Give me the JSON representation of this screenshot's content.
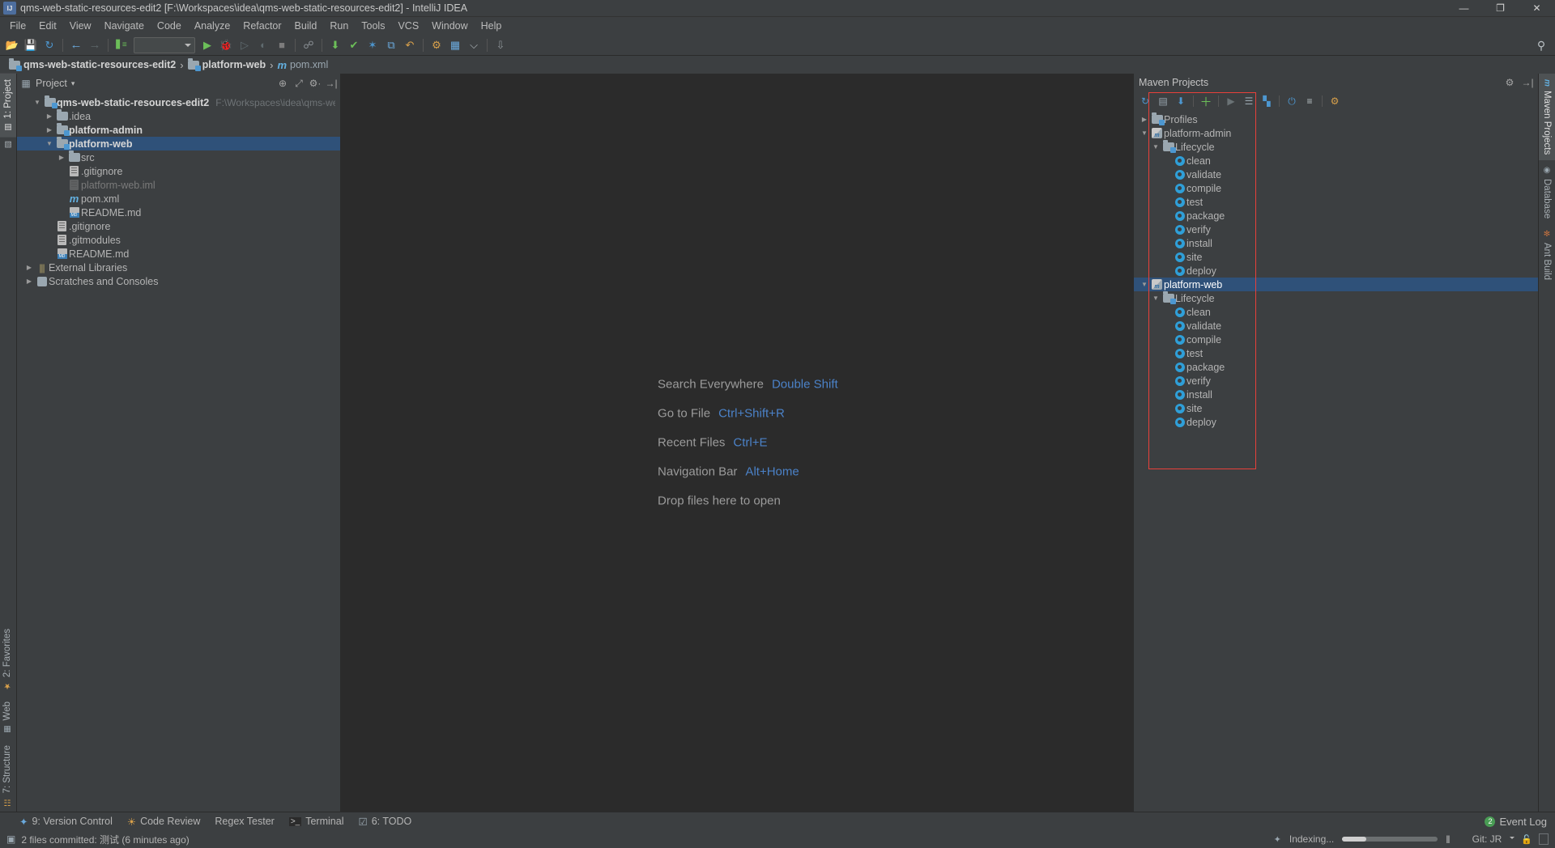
{
  "window": {
    "title": "qms-web-static-resources-edit2 [F:\\Workspaces\\idea\\qms-web-static-resources-edit2] - IntelliJ IDEA",
    "app_icon": "intellij-idea-icon",
    "minimize_label": "—",
    "maximize_label": "❐",
    "close_label": "✕"
  },
  "menu": {
    "items": [
      {
        "label": "File"
      },
      {
        "label": "Edit"
      },
      {
        "label": "View"
      },
      {
        "label": "Navigate"
      },
      {
        "label": "Code"
      },
      {
        "label": "Analyze"
      },
      {
        "label": "Refactor"
      },
      {
        "label": "Build"
      },
      {
        "label": "Run"
      },
      {
        "label": "Tools"
      },
      {
        "label": "VCS"
      },
      {
        "label": "Window"
      },
      {
        "label": "Help"
      }
    ]
  },
  "toolbar": {
    "buttons": [
      {
        "name": "open-project-icon",
        "glyph": "📂",
        "color": "#d9a14b"
      },
      {
        "name": "save-all-icon",
        "glyph": "💾",
        "color": "#b9c0c4"
      },
      {
        "name": "sync-icon",
        "glyph": "↻",
        "color": "#4d97d0"
      },
      {
        "name": "back-arrow-icon",
        "glyph": "←",
        "color": "#6aa9dc"
      },
      {
        "name": "forward-arrow-icon",
        "glyph": "→",
        "color": "#5c6669"
      },
      {
        "name": "compile-icon",
        "glyph": "▐",
        "color": "#6cbf59"
      }
    ],
    "run_config_value": "",
    "run_buttons": [
      {
        "name": "run-icon",
        "glyph": "▶",
        "color": "#6cbf59"
      },
      {
        "name": "debug-icon",
        "glyph": "🐞",
        "color": "#5f6a6e"
      },
      {
        "name": "run-coverage-icon",
        "glyph": "▷",
        "color": "#5f6a6e"
      },
      {
        "name": "profile-icon",
        "glyph": "◔",
        "color": "#5f6a6e"
      },
      {
        "name": "stop-icon",
        "glyph": "■",
        "color": "#7c7c7c"
      }
    ],
    "right_buttons": [
      {
        "name": "update-project-icon",
        "glyph": "⬇",
        "color": "#6cbf59"
      },
      {
        "name": "commit-icon",
        "glyph": "✔",
        "color": "#6cbf59"
      },
      {
        "name": "vcs-push-icon",
        "glyph": "✦",
        "color": "#4d97d0"
      },
      {
        "name": "vcs-history-icon",
        "glyph": "⧉",
        "color": "#6aa9dc"
      },
      {
        "name": "undo-icon",
        "glyph": "↶",
        "color": "#d9a14b"
      },
      {
        "name": "settings-icon",
        "glyph": "⚙",
        "color": "#d9a14b"
      },
      {
        "name": "project-structure-icon",
        "glyph": "▦",
        "color": "#6aa9dc"
      },
      {
        "name": "search-everywhere-icon",
        "glyph": "⌕",
        "color": "#b9c0c4"
      }
    ],
    "far_right": [
      {
        "name": "search-icon",
        "glyph": "⌕"
      }
    ]
  },
  "breadcrumb": {
    "items": [
      {
        "label": "qms-web-static-resources-edit2",
        "icon": "module-folder-icon",
        "bold": true
      },
      {
        "label": "platform-web",
        "icon": "module-folder-icon",
        "bold": true
      },
      {
        "label": "pom.xml",
        "icon": "maven-file-icon",
        "bold": false
      }
    ],
    "separator": "›"
  },
  "left_rail": {
    "top": [
      {
        "label": "1: Project",
        "icon": "project-icon",
        "active": true
      },
      {
        "label": "",
        "icon": "structure-small-icon",
        "active": false
      }
    ],
    "bottom": [
      {
        "label": "2: Favorites",
        "icon": "star-icon",
        "active": false
      },
      {
        "label": "Web",
        "icon": "web-icon",
        "active": false
      },
      {
        "label": "7: Structure",
        "icon": "structure-icon",
        "active": false
      }
    ]
  },
  "right_rail": {
    "items": [
      {
        "label": "Maven Projects",
        "icon": "maven-icon",
        "active": true
      },
      {
        "label": "Database",
        "icon": "database-icon",
        "active": false
      },
      {
        "label": "Ant Build",
        "icon": "ant-icon",
        "active": false
      }
    ]
  },
  "project_panel": {
    "title": "Project",
    "title_icon": "project-view-icon",
    "dropdown_caret": "▾",
    "header_icons": [
      {
        "name": "locate-icon",
        "glyph": "⊕"
      },
      {
        "name": "expand-all-icon",
        "glyph": "⤢"
      },
      {
        "name": "collapse-all-icon",
        "glyph": "⚙·"
      },
      {
        "name": "hide-icon",
        "glyph": "→|"
      }
    ],
    "tree": [
      {
        "label": "qms-web-static-resources-edit2",
        "indent": 0,
        "twist": "▼",
        "icon": "project-folder-icon",
        "bold": true,
        "path": "F:\\Workspaces\\idea\\qms-web-static-re"
      },
      {
        "label": ".idea",
        "indent": 1,
        "twist": "▶",
        "icon": "folder-icon",
        "bold": false,
        "path": ""
      },
      {
        "label": "platform-admin",
        "indent": 1,
        "twist": "▶",
        "icon": "module-folder-icon",
        "bold": true,
        "path": ""
      },
      {
        "label": "platform-web",
        "indent": 1,
        "twist": "▼",
        "icon": "module-folder-icon",
        "bold": true,
        "path": "",
        "selected": true
      },
      {
        "label": "src",
        "indent": 2,
        "twist": "▶",
        "icon": "folder-icon",
        "bold": false,
        "path": ""
      },
      {
        "label": ".gitignore",
        "indent": 3,
        "twist": "",
        "icon": "file-icon",
        "bold": false,
        "path": ""
      },
      {
        "label": "platform-web.iml",
        "indent": 3,
        "twist": "",
        "icon": "iml-file-icon",
        "bold": false,
        "dim": true,
        "path": ""
      },
      {
        "label": "pom.xml",
        "indent": 3,
        "twist": "",
        "icon": "maven-file-icon",
        "bold": false,
        "path": ""
      },
      {
        "label": "README.md",
        "indent": 3,
        "twist": "",
        "icon": "markdown-file-icon",
        "bold": false,
        "path": ""
      },
      {
        "label": ".gitignore",
        "indent": 2,
        "twist": "",
        "icon": "file-icon",
        "bold": false,
        "path": ""
      },
      {
        "label": ".gitmodules",
        "indent": 2,
        "twist": "",
        "icon": "file-icon",
        "bold": false,
        "path": ""
      },
      {
        "label": "README.md",
        "indent": 2,
        "twist": "",
        "icon": "markdown-file-icon",
        "bold": false,
        "path": ""
      },
      {
        "label": "External Libraries",
        "indent": 0,
        "twist": "▶",
        "icon": "library-icon",
        "bold": false,
        "path": ""
      },
      {
        "label": "Scratches and Consoles",
        "indent": 0,
        "twist": "▶",
        "icon": "scratches-icon",
        "bold": false,
        "path": ""
      }
    ]
  },
  "editor": {
    "hints": [
      {
        "label": "Search Everywhere",
        "shortcut": "Double Shift"
      },
      {
        "label": "Go to File",
        "shortcut": "Ctrl+Shift+R"
      },
      {
        "label": "Recent Files",
        "shortcut": "Ctrl+E"
      },
      {
        "label": "Navigation Bar",
        "shortcut": "Alt+Home"
      },
      {
        "label": "Drop files here to open",
        "shortcut": ""
      }
    ]
  },
  "maven_panel": {
    "title": "Maven Projects",
    "header_icons": [
      {
        "name": "gear-icon",
        "glyph": "⚙"
      },
      {
        "name": "hide-panel-icon",
        "glyph": "→|"
      }
    ],
    "toolbar": [
      {
        "name": "reimport-icon",
        "glyph": "↻",
        "color": "#4d97d0"
      },
      {
        "name": "generate-sources-icon",
        "glyph": "▤",
        "color": "#9aa7b0"
      },
      {
        "name": "download-sources-icon",
        "glyph": "⬇",
        "color": "#4d97d0"
      },
      {
        "name": "add-maven-project-icon",
        "glyph": "＋",
        "color": "#6cbf59"
      },
      {
        "name": "run-goal-icon",
        "glyph": "▶",
        "color": "#6a7275"
      },
      {
        "name": "toggle-offline-icon",
        "glyph": "☰",
        "color": "#9aa7b0"
      },
      {
        "name": "skip-tests-icon",
        "glyph": "⬚",
        "color": "#4d97d0"
      },
      {
        "name": "execute-goal-icon",
        "glyph": "⚡",
        "color": "#4d97d0"
      },
      {
        "name": "collapse-all-icon",
        "glyph": "≡",
        "color": "#b9c0c4"
      },
      {
        "name": "show-settings-icon",
        "glyph": "⚙",
        "color": "#d9a14b"
      }
    ],
    "tree": [
      {
        "label": "Profiles",
        "indent": 0,
        "twist": "▶",
        "icon": "profiles-folder-icon"
      },
      {
        "label": "platform-admin",
        "indent": 0,
        "twist": "▼",
        "icon": "maven-project-icon"
      },
      {
        "label": "Lifecycle",
        "indent": 1,
        "twist": "▼",
        "icon": "lifecycle-folder-icon"
      },
      {
        "label": "clean",
        "indent": 2,
        "twist": "",
        "icon": "goal-icon"
      },
      {
        "label": "validate",
        "indent": 2,
        "twist": "",
        "icon": "goal-icon"
      },
      {
        "label": "compile",
        "indent": 2,
        "twist": "",
        "icon": "goal-icon"
      },
      {
        "label": "test",
        "indent": 2,
        "twist": "",
        "icon": "goal-icon"
      },
      {
        "label": "package",
        "indent": 2,
        "twist": "",
        "icon": "goal-icon"
      },
      {
        "label": "verify",
        "indent": 2,
        "twist": "",
        "icon": "goal-icon"
      },
      {
        "label": "install",
        "indent": 2,
        "twist": "",
        "icon": "goal-icon"
      },
      {
        "label": "site",
        "indent": 2,
        "twist": "",
        "icon": "goal-icon"
      },
      {
        "label": "deploy",
        "indent": 2,
        "twist": "",
        "icon": "goal-icon"
      },
      {
        "label": "platform-web",
        "indent": 0,
        "twist": "▼",
        "icon": "maven-project-icon",
        "selected": true
      },
      {
        "label": "Lifecycle",
        "indent": 1,
        "twist": "▼",
        "icon": "lifecycle-folder-icon"
      },
      {
        "label": "clean",
        "indent": 2,
        "twist": "",
        "icon": "goal-icon"
      },
      {
        "label": "validate",
        "indent": 2,
        "twist": "",
        "icon": "goal-icon"
      },
      {
        "label": "compile",
        "indent": 2,
        "twist": "",
        "icon": "goal-icon"
      },
      {
        "label": "test",
        "indent": 2,
        "twist": "",
        "icon": "goal-icon"
      },
      {
        "label": "package",
        "indent": 2,
        "twist": "",
        "icon": "goal-icon"
      },
      {
        "label": "verify",
        "indent": 2,
        "twist": "",
        "icon": "goal-icon"
      },
      {
        "label": "install",
        "indent": 2,
        "twist": "",
        "icon": "goal-icon"
      },
      {
        "label": "site",
        "indent": 2,
        "twist": "",
        "icon": "goal-icon"
      },
      {
        "label": "deploy",
        "indent": 2,
        "twist": "",
        "icon": "goal-icon"
      }
    ],
    "annotation_color": "#e8403a"
  },
  "bottom_tabs": {
    "items": [
      {
        "label": "9: Version Control",
        "icon": "version-control-icon"
      },
      {
        "label": "Code Review",
        "icon": "code-review-icon"
      },
      {
        "label": "Regex Tester",
        "icon": ""
      },
      {
        "label": "Terminal",
        "icon": "terminal-icon"
      },
      {
        "label": "6: TODO",
        "icon": "todo-icon"
      }
    ],
    "event_log_label": "Event Log",
    "event_log_count": "2"
  },
  "statusbar": {
    "message": "2 files committed: 测试 (6 minutes ago)",
    "message_icon": "commit-icon",
    "indexing_label": "Indexing...",
    "indexing_icon": "spinner-icon",
    "progress_percent": 25,
    "pause_label": "‖",
    "git_label": "Git: JR",
    "lock_icon": "lock-icon",
    "memory_icon": "memory-indicator"
  }
}
